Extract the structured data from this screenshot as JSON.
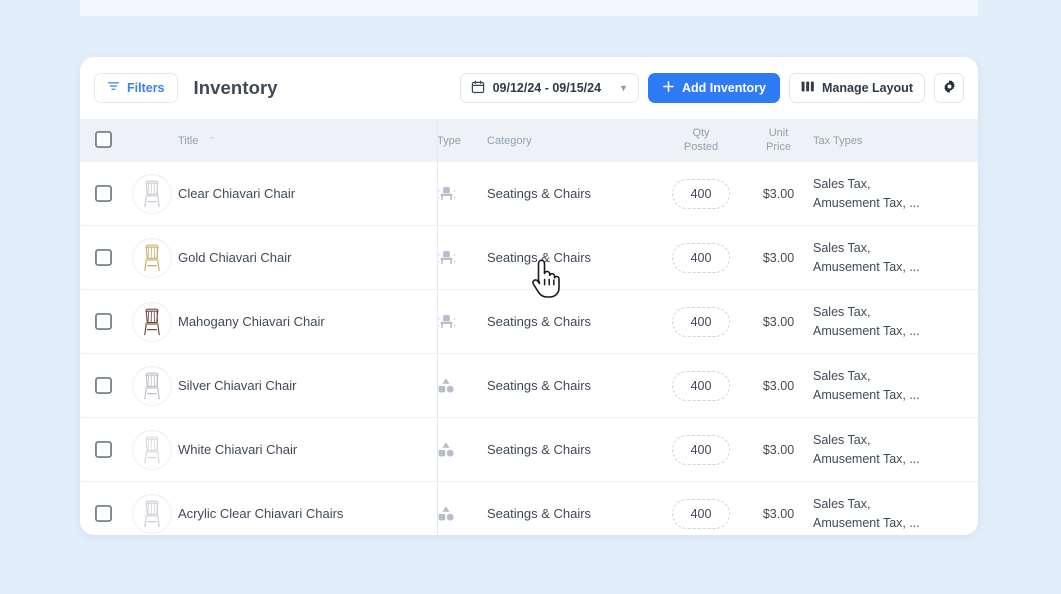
{
  "app": {
    "background_color": "#e3eefb",
    "card_color": "#ffffff"
  },
  "toolbar": {
    "filters_label": "Filters",
    "filters_icon": "filter-funnel-icon",
    "page_title": "Inventory",
    "date_range": "09/12/24 - 09/15/24",
    "date_icon": "calendar-icon",
    "date_caret": "▼",
    "add_inventory_label": "Add Inventory",
    "add_inventory_icon": "plus-icon",
    "add_inventory_color": "#2f7bf6",
    "manage_layout_label": "Manage Layout",
    "manage_layout_icon": "columns-icon",
    "settings_icon": "gear-icon"
  },
  "table": {
    "header": {
      "select_all": "",
      "title": "Title",
      "sort_indicator": "⌃",
      "type": "Type",
      "category": "Category",
      "qty_posted_line1": "Qty",
      "qty_posted_line2": "Posted",
      "unit_price_line1": "Unit",
      "unit_price_line2": "Price",
      "tax_types": "Tax Types"
    },
    "rows": [
      {
        "title": "Clear Chiavari Chair",
        "thumb_icon": "clear-chiavari-chair-thumb",
        "thumb_color": "#c9ccd1",
        "type_icon": "chair-icon",
        "category": "Seatings & Chairs",
        "qty_posted": "400",
        "unit_price": "$3.00",
        "tax_line1": "Sales Tax,",
        "tax_line2": "Amusement Tax, ..."
      },
      {
        "title": "Gold Chiavari Chair",
        "thumb_icon": "gold-chiavari-chair-thumb",
        "thumb_color": "#c9b072",
        "type_icon": "chair-icon",
        "category": "Seatings & Chairs",
        "qty_posted": "400",
        "unit_price": "$3.00",
        "tax_line1": "Sales Tax,",
        "tax_line2": "Amusement Tax, ..."
      },
      {
        "title": "Mahogany Chiavari Chair",
        "thumb_icon": "mahogany-chiavari-chair-thumb",
        "thumb_color": "#6b4a42",
        "type_icon": "chair-icon",
        "category": "Seatings & Chairs",
        "qty_posted": "400",
        "unit_price": "$3.00",
        "tax_line1": "Sales Tax,",
        "tax_line2": "Amusement Tax, ..."
      },
      {
        "title": "Silver Chiavari Chair",
        "thumb_icon": "silver-chiavari-chair-thumb",
        "thumb_color": "#bcc0c6",
        "type_icon": "shapes-icon",
        "category": "Seatings & Chairs",
        "qty_posted": "400",
        "unit_price": "$3.00",
        "tax_line1": "Sales Tax,",
        "tax_line2": "Amusement Tax, ..."
      },
      {
        "title": "White Chiavari Chair",
        "thumb_icon": "white-chiavari-chair-thumb",
        "thumb_color": "#d7dade",
        "type_icon": "shapes-icon",
        "category": "Seatings & Chairs",
        "qty_posted": "400",
        "unit_price": "$3.00",
        "tax_line1": "Sales Tax,",
        "tax_line2": "Amusement Tax, ..."
      },
      {
        "title": "Acrylic Clear Chiavari Chairs",
        "thumb_icon": "acrylic-clear-chiavari-chairs-thumb",
        "thumb_color": "#ccd0d5",
        "type_icon": "shapes-icon",
        "category": "Seatings & Chairs",
        "qty_posted": "400",
        "unit_price": "$3.00",
        "tax_line1": "Sales Tax,",
        "tax_line2": "Amusement Tax, ..."
      }
    ]
  },
  "cursor": {
    "icon": "pointing-hand-cursor"
  }
}
